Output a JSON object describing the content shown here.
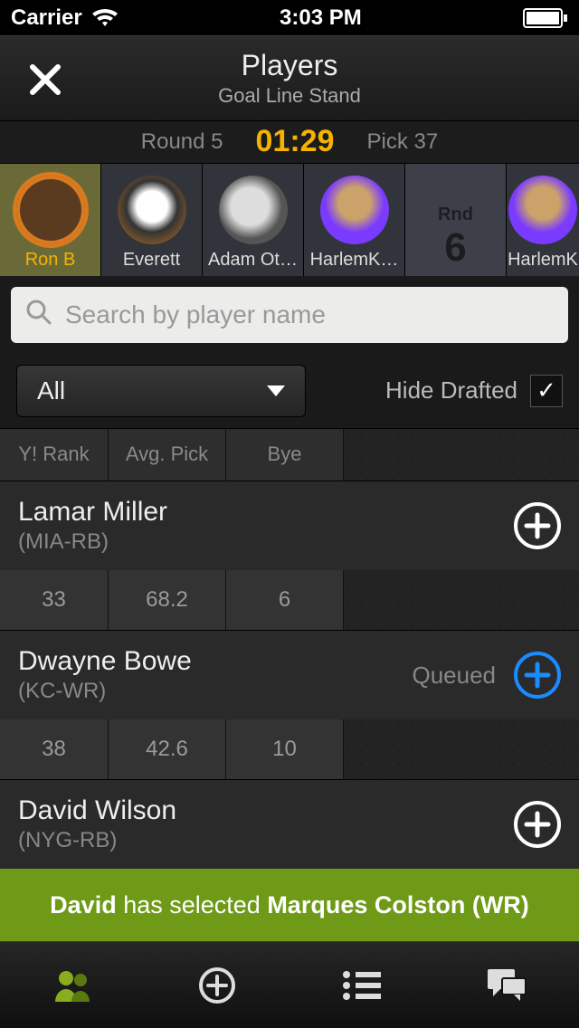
{
  "status": {
    "carrier": "Carrier",
    "time": "3:03 PM"
  },
  "header": {
    "title": "Players",
    "subtitle": "Goal Line Stand"
  },
  "round": {
    "round_label": "Round 5",
    "timer": "01:29",
    "pick_label": "Pick 37"
  },
  "drafters": [
    {
      "name": "Ron B",
      "active": true
    },
    {
      "name": "Everett"
    },
    {
      "name": "Adam Ot…"
    },
    {
      "name": "HarlemK…"
    },
    {
      "round_marker": true,
      "rnd_label": "Rnd",
      "rnd_num": "6"
    },
    {
      "name": "HarlemK"
    }
  ],
  "search": {
    "placeholder": "Search by player name"
  },
  "filter": {
    "dropdown": "All",
    "hide_label": "Hide Drafted",
    "checked": true
  },
  "columns": {
    "rank": "Y! Rank",
    "avg": "Avg. Pick",
    "bye": "Bye"
  },
  "players": [
    {
      "name": "Lamar Miller",
      "team": "(MIA-RB)",
      "rank": "33",
      "avg": "68.2",
      "bye": "6",
      "queued": false
    },
    {
      "name": "Dwayne Bowe",
      "team": "(KC-WR)",
      "rank": "38",
      "avg": "42.6",
      "bye": "10",
      "queued": true,
      "queued_label": "Queued"
    },
    {
      "name": "David Wilson",
      "team": "(NYG-RB)",
      "queued": false
    }
  ],
  "toast": {
    "actor": "David",
    "mid": " has selected ",
    "target": "Marques Colston (WR)"
  },
  "tabs": {
    "active": 0
  }
}
